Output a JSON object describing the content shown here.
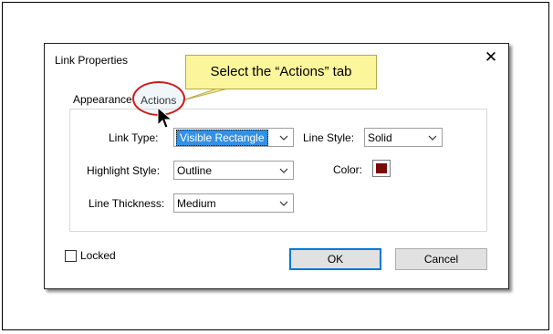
{
  "callout": {
    "text": "Select the “Actions” tab"
  },
  "dialog": {
    "title": "Link Properties",
    "close_icon": "close-icon"
  },
  "tabs": [
    {
      "label": "Appearance",
      "active": true
    },
    {
      "label": "Actions",
      "active": false
    }
  ],
  "appearance": {
    "link_type": {
      "label": "Link Type:",
      "value": "Visible Rectangle"
    },
    "highlight_style": {
      "label": "Highlight Style:",
      "value": "Outline"
    },
    "line_thickness": {
      "label": "Line Thickness:",
      "value": "Medium"
    },
    "line_style": {
      "label": "Line Style:",
      "value": "Solid"
    },
    "color": {
      "label": "Color:",
      "swatch": "#7a0a0a"
    }
  },
  "footer": {
    "locked_label": "Locked",
    "locked_checked": false,
    "ok_label": "OK",
    "cancel_label": "Cancel"
  },
  "icons": {
    "dropdown": "chevron-down-icon",
    "pointer": "mouse-pointer-icon"
  }
}
